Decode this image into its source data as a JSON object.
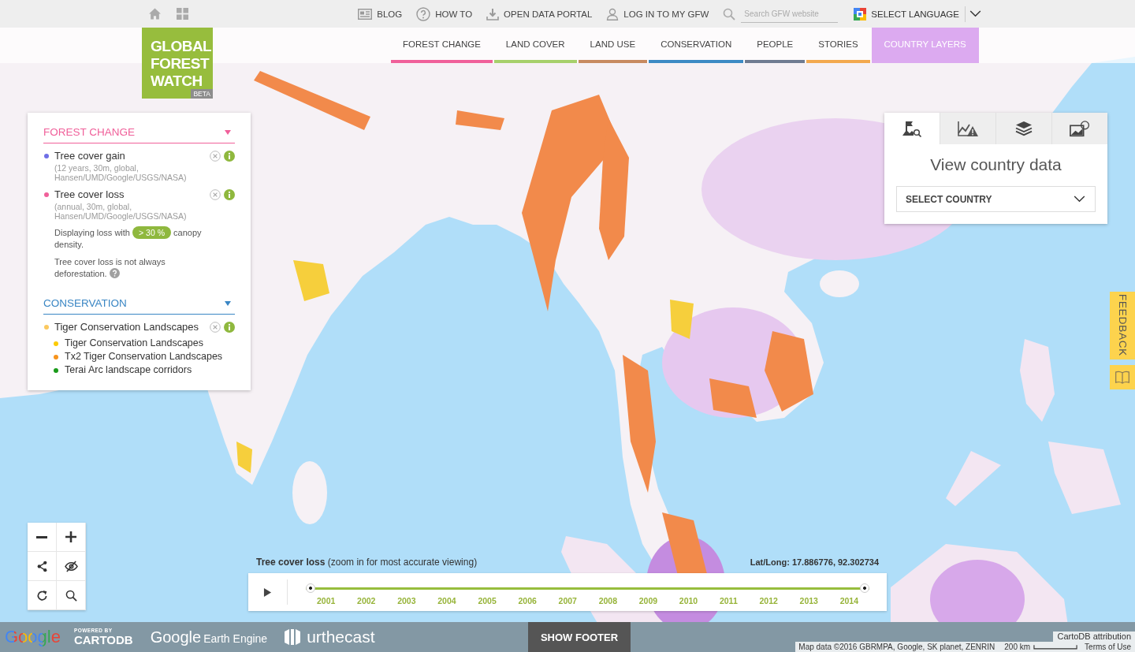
{
  "top_bar": {
    "links": [
      "BLOG",
      "HOW TO",
      "OPEN DATA PORTAL",
      "LOG IN TO MY GFW"
    ],
    "search": {
      "placeholder": "Search GFW website"
    },
    "language": "SELECT LANGUAGE"
  },
  "logo": {
    "text": "GLOBAL FOREST WATCH",
    "badge": "BETA"
  },
  "nav_tabs": [
    {
      "label": "FOREST CHANGE",
      "kind": "underlined",
      "color": "#f0609a"
    },
    {
      "label": "LAND COVER",
      "kind": "underlined",
      "color": "#a7d06b"
    },
    {
      "label": "LAND USE",
      "kind": "underlined",
      "color": "#c78a60"
    },
    {
      "label": "CONSERVATION",
      "kind": "underlined",
      "color": "#3c8ac4"
    },
    {
      "label": "PEOPLE",
      "kind": "underlined",
      "color": "#6f7b91"
    },
    {
      "label": "STORIES",
      "kind": "underlined",
      "color": "#f3a94e"
    },
    {
      "label": "COUNTRY LAYERS",
      "kind": "filled",
      "color": "#dcaaf0"
    }
  ],
  "legend": {
    "sections": [
      {
        "title": "FOREST CHANGE",
        "color": "#f0609a",
        "expanded": true,
        "layers": [
          {
            "name": "Tree cover gain",
            "color": "#6f6fe6",
            "details": "(12 years, 30m, global, Hansen/UMD/Google/USGS/NASA)"
          },
          {
            "name": "Tree cover loss",
            "color": "#f0609a",
            "details": "(annual, 30m, global, Hansen/UMD/Google/USGS/NASA)",
            "threshold_note": {
              "before": "Displaying loss with",
              "threshold": "> 30 %",
              "after": "canopy density."
            },
            "caveat": "Tree cover loss is not always deforestation."
          }
        ]
      },
      {
        "title": "CONSERVATION",
        "color": "#3a86c4",
        "expanded": true,
        "layers": [
          {
            "name": "Tiger Conservation Landscapes",
            "color": "#fbc95f",
            "children": [
              {
                "name": "Tiger Conservation Landscapes",
                "color": "#fccb05"
              },
              {
                "name": "Tx2 Tiger Conservation Landscapes",
                "color": "#f7941d"
              },
              {
                "name": "Terai Arc landscape corridors",
                "color": "#1a9a1a"
              }
            ]
          }
        ]
      }
    ]
  },
  "country_panel": {
    "tabs": [
      {
        "selected": true
      },
      {
        "selected": false
      },
      {
        "selected": false
      },
      {
        "selected": false
      }
    ],
    "title": "View country data",
    "select": "SELECT COUNTRY"
  },
  "feedback": "FEEDBACK",
  "timeline": {
    "caption": "**Tree cover loss** (zoom in for most accurate viewing)",
    "coordinates": "Lat/Long: 17.886776, 92.302734",
    "level": 1,
    "years": [
      "2001",
      "2002",
      "2003",
      "2004",
      "2005",
      "2006",
      "2007",
      "2008",
      "2009",
      "2010",
      "2011",
      "2012",
      "2013",
      "2014"
    ]
  },
  "footer_bar": {
    "google": "Google",
    "cartodb_caption": "POWERED BY",
    "cartodb": "CARTODB",
    "earth_engine": [
      "Google",
      "Earth Engine"
    ],
    "urthecast": "urthecast",
    "button": "SHOW FOOTER"
  },
  "attribution": {
    "cartodb": "CartoDB attribution",
    "map_data": "Map data ©2016 GBRMPA, Google, SK planet, ZENRIN",
    "scale": "200 km",
    "terms": "Terms of Use"
  }
}
